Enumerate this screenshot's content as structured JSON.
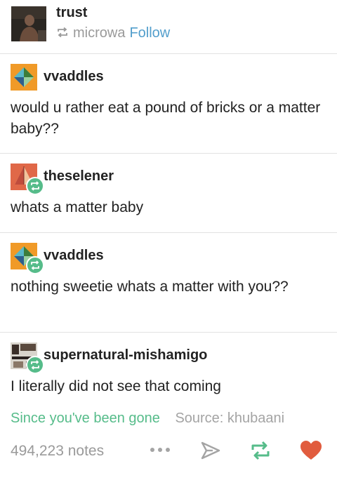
{
  "header": {
    "title": "trust",
    "via_user": "microwa",
    "follow_label": "Follow"
  },
  "posts": [
    {
      "username": "vvaddles",
      "text": "would u rather eat a pound of bricks or a matter baby??"
    },
    {
      "username": "theselener",
      "text": "whats a matter baby"
    },
    {
      "username": "vvaddles",
      "text": "nothing sweetie whats a matter with you??"
    },
    {
      "username": "supernatural-mishamigo",
      "text": "I literally did not see that coming"
    }
  ],
  "tags": {
    "tag": "Since you've been gone",
    "source": "Source: khubaani"
  },
  "footer": {
    "notes": "494,223 notes",
    "icons": [
      "more-icon",
      "share-icon",
      "reblog-icon",
      "like-icon"
    ]
  },
  "colors": {
    "accent_blue": "#529ecc",
    "reblog_green": "#56bc8a",
    "like_red": "#e15c3e",
    "muted_gray": "#9a9a9a"
  }
}
